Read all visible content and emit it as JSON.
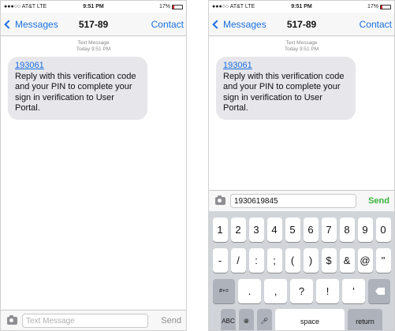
{
  "status": {
    "carrier": "●●●○○ AT&T  LTE",
    "time": "9:51 PM",
    "battery": "17%",
    "battery_fraction": 0.17
  },
  "nav": {
    "back_label": "Messages",
    "title": "517-89",
    "contact_label": "Contact"
  },
  "thread": {
    "meta_type": "Text Message",
    "meta_time": "Today 9:51 PM",
    "code_link": "193061",
    "message": "Reply with this verification code and your PIN to complete your sign in verification to User Portal."
  },
  "composer_left": {
    "placeholder": "Text Message",
    "send_label": "Send"
  },
  "composer_right": {
    "value": "1930619845",
    "send_label": "Send"
  },
  "keyboard": {
    "row1": [
      "1",
      "2",
      "3",
      "4",
      "5",
      "6",
      "7",
      "8",
      "9",
      "0"
    ],
    "row2": [
      "-",
      "/",
      ":",
      ";",
      "(",
      ")",
      "$",
      "&",
      "@",
      "\""
    ],
    "row3": [
      ".",
      ",",
      "?",
      "!",
      "'"
    ],
    "symbols_key": "#+=",
    "abc_key": "ABC",
    "space_key": "space",
    "return_key": "return"
  },
  "colors": {
    "accent": "#1a6fe0",
    "send_active": "#3cb13c",
    "bubble": "#e6e6eb"
  }
}
